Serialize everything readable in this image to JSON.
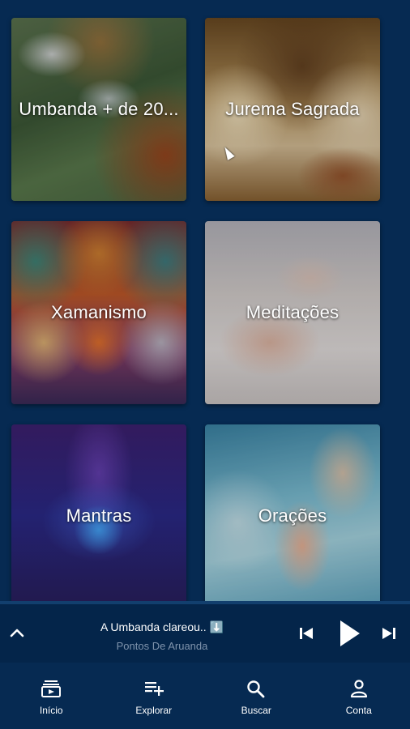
{
  "tiles": [
    {
      "label": "Umbanda + de 20..."
    },
    {
      "label": "Jurema Sagrada"
    },
    {
      "label": "Xamanismo"
    },
    {
      "label": "Meditações"
    },
    {
      "label": "Mantras"
    },
    {
      "label": "Orações"
    }
  ],
  "player": {
    "title": "A Umbanda clareou.. ⬇️",
    "subtitle": "Pontos De Aruanda"
  },
  "nav": {
    "items": [
      {
        "label": "Início",
        "icon": "library-icon"
      },
      {
        "label": "Explorar",
        "icon": "playlist-add-icon"
      },
      {
        "label": "Buscar",
        "icon": "search-icon"
      },
      {
        "label": "Conta",
        "icon": "person-icon"
      }
    ]
  },
  "colors": {
    "background": "#062a52",
    "player_bg": "#04254a",
    "subtitle": "#7f93ac"
  }
}
